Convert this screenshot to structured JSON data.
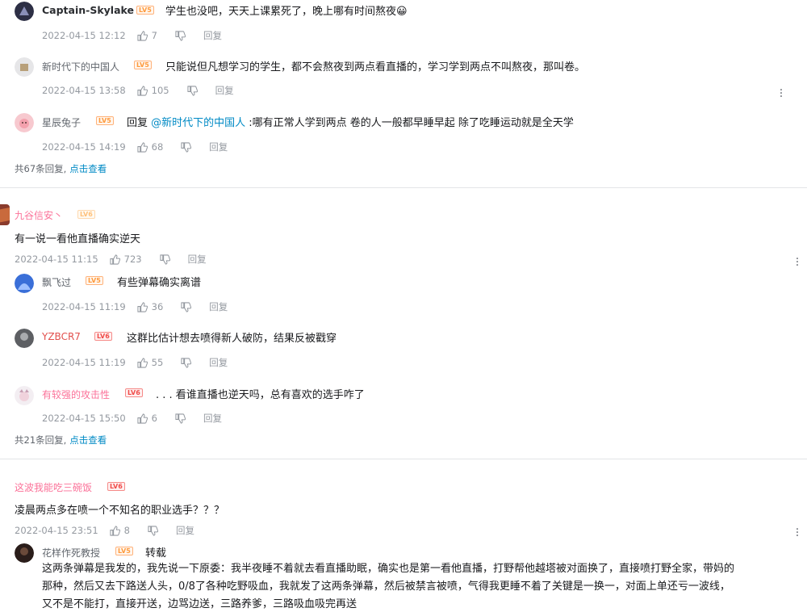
{
  "thread1": {
    "c1": {
      "user": "Captain-Skylake",
      "level": "LV5",
      "text": "学生也没吧，天天上课累死了，晚上哪有时间熬夜😀",
      "time": "2022-04-15 12:12",
      "likes": "7",
      "reply_label": "回复"
    },
    "c2": {
      "user": "新时代下的中国人",
      "level": "LV5",
      "text": "只能说但凡想学习的学生，都不会熬夜到两点看直播的，学习学到两点不叫熬夜，那叫卷。",
      "time": "2022-04-15 13:58",
      "likes": "105",
      "reply_label": "回复"
    },
    "c3": {
      "user": "星辰兔子",
      "level": "LV5",
      "prefix": "回复 ",
      "mention": "@新时代下的中国人",
      "text": " :哪有正常人学到两点 卷的人一般都早睡早起 除了吃睡运动就是全天学",
      "time": "2022-04-15 14:19",
      "likes": "68",
      "reply_label": "回复"
    },
    "summary": "共67条回复,",
    "summary_link": "点击查看"
  },
  "thread2": {
    "main": {
      "user": "九谷信安丶",
      "level": "LV6",
      "text": "有一说一看他直播确实逆天",
      "time": "2022-04-15 11:15",
      "likes": "723",
      "reply_label": "回复"
    },
    "c1": {
      "user": "飘飞过",
      "level": "LV5",
      "text": "有些弹幕确实离谱",
      "time": "2022-04-15 11:19",
      "likes": "36",
      "reply_label": "回复"
    },
    "c2": {
      "user": "YZBCR7",
      "level": "LV6",
      "text": "这群比估计想去喷得新人破防，结果反被戳穿",
      "time": "2022-04-15 11:19",
      "likes": "55",
      "reply_label": "回复"
    },
    "c3": {
      "user": "有较强的攻击性",
      "level": "LV6",
      "text": ". . .   看谁直播也逆天吗，总有喜欢的选手咋了",
      "time": "2022-04-15 15:50",
      "likes": "6",
      "reply_label": "回复"
    },
    "summary": "共21条回复,",
    "summary_link": "点击查看"
  },
  "thread3": {
    "main": {
      "user": "这波我能吃三碗饭",
      "level": "LV6",
      "text": "凌晨两点多在喷一个不知名的职业选手？？？",
      "time": "2022-04-15 23:51",
      "likes": "8",
      "reply_label": "回复"
    },
    "c1": {
      "user": "花样作死教授",
      "level": "LV5",
      "tag": "转载",
      "text_lines": [
        "这两条弹幕是我发的，我先说一下原委：我半夜睡不着就去看直播助眠，确实也是第一看他直播，打野帮他越塔被对面换了，直接喷打野全家，带妈的",
        "那种，然后又去下路送人头，0/8了各种吃野吸血，我就发了这两条弹幕，然后被禁言被喷，气得我更睡不着了关键是一换一，对面上单还亏一波线，",
        "又不是不能打，直接开送，边骂边送，三路养爹，三路吸血吸完再送"
      ]
    }
  },
  "colors": {
    "accent_link": "#008ac5",
    "level_orange": "#ff9a3c",
    "level_red": "#f04c49",
    "pink_name": "#fb7299"
  }
}
